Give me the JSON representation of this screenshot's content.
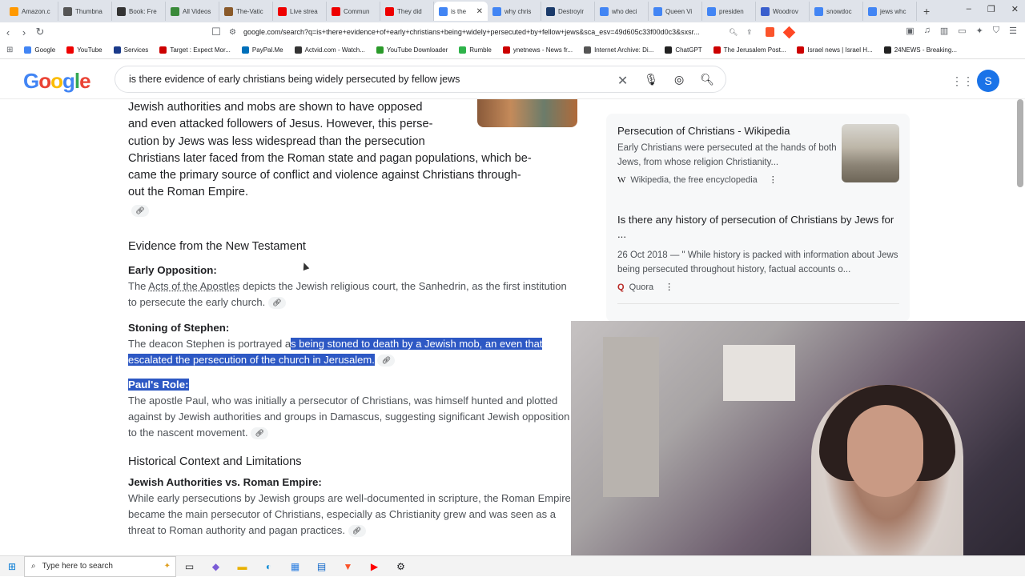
{
  "browser": {
    "tabs": [
      "Amazon.c",
      "Thumbna",
      "Book: Fre",
      "All Videos",
      "The-Vatic",
      "Live strea",
      "Commun",
      "They did",
      "is the",
      "why chris",
      "Destroyir",
      "who deci",
      "Queen Vi",
      "presiden",
      "Woodrov",
      "snowdoc",
      "jews whc"
    ],
    "active_tab_index": 8,
    "new_tab": "+",
    "url": "google.com/search?q=is+there+evidence+of+early+christians+being+widely+persecuted+by+fellow+jews&sca_esv=49d605c33f00d0c3&sxsr...",
    "bookmarks": [
      "Google",
      "YouTube",
      "Services",
      "Target : Expect Mor...",
      "PayPal.Me",
      "Actvid.com - Watch...",
      "YouTube Downloader",
      "Rumble",
      "ynetnews - News fr...",
      "Internet Archive: Di...",
      "ChatGPT",
      "The Jerusalem Post...",
      "Israel news | Israel H...",
      "24NEWS - Breaking..."
    ]
  },
  "google": {
    "logo": "Google",
    "query": "is there evidence of early christians being widely persecuted by fellow jews",
    "avatar_letter": "S"
  },
  "main": {
    "intro": "Jewish authorities and mobs are shown to have opposed and even attacked followers of Jesus. However, this persecution by Jews was less widespread than the persecution Christians later faced from the Roman state and pagan populations, which became the primary source of conflict and violence against Christians throughout the Roman Empire.",
    "intro_lines": [
      "Jewish authorities and mobs are shown to have opposed",
      "and even attacked followers of Jesus. However, this perse-",
      "cution by Jews was less widespread than the persecution",
      "Christians later faced from the Roman state and pagan populations, which be-",
      "came the primary source of conflict and violence against Christians through-",
      "out the Roman Empire."
    ],
    "section1": "Evidence from the New Testament",
    "early_opp_label": "Early Opposition:",
    "early_opp_pre": "The ",
    "early_opp_link": "Acts of the Apostles",
    "early_opp_post": " depicts the Jewish religious court, the Sanhedrin, as the first institution to persecute the early church.",
    "stephen_label": "Stoning of Stephen:",
    "stephen_pre": "The deacon Stephen is portrayed a",
    "stephen_sel": "s being stoned to death by a Jewish mob, an even that escalated the persecution of the church in Jerusalem.",
    "paul_label": "Paul's Role:",
    "paul_text": "The apostle Paul, who was initially a persecutor of Christians, was himself hunted and plotted against by Jewish authorities and groups in Damascus, suggesting significant Jewish opposition to the nascent movement.",
    "section2": "Historical Context and Limitations",
    "authorities_label": "Jewish Authorities vs. Roman Empire:",
    "authorities_text": "While early persecutions by Jewish groups are well-documented in scripture, the Roman Empire became the main persecutor of Christians, especially as Christianity grew and was seen as a threat to Roman authority and pagan practices."
  },
  "sources": [
    {
      "title": "Persecution of Christians - Wikipedia",
      "snippet": "Early Christians were persecuted at the hands of both Jews, from whose religion Christianity...",
      "source": "Wikipedia, the free encyclopedia",
      "icon": "W"
    },
    {
      "title": "Is there any history of persecution of Christians by Jews for ...",
      "snippet": "26 Oct 2018 — \" While history is packed with information about Jews being persecuted throughout history, factual accounts o...",
      "source": "Quora",
      "icon": "Q"
    }
  ],
  "taskbar": {
    "search_placeholder": "Type here to search"
  }
}
